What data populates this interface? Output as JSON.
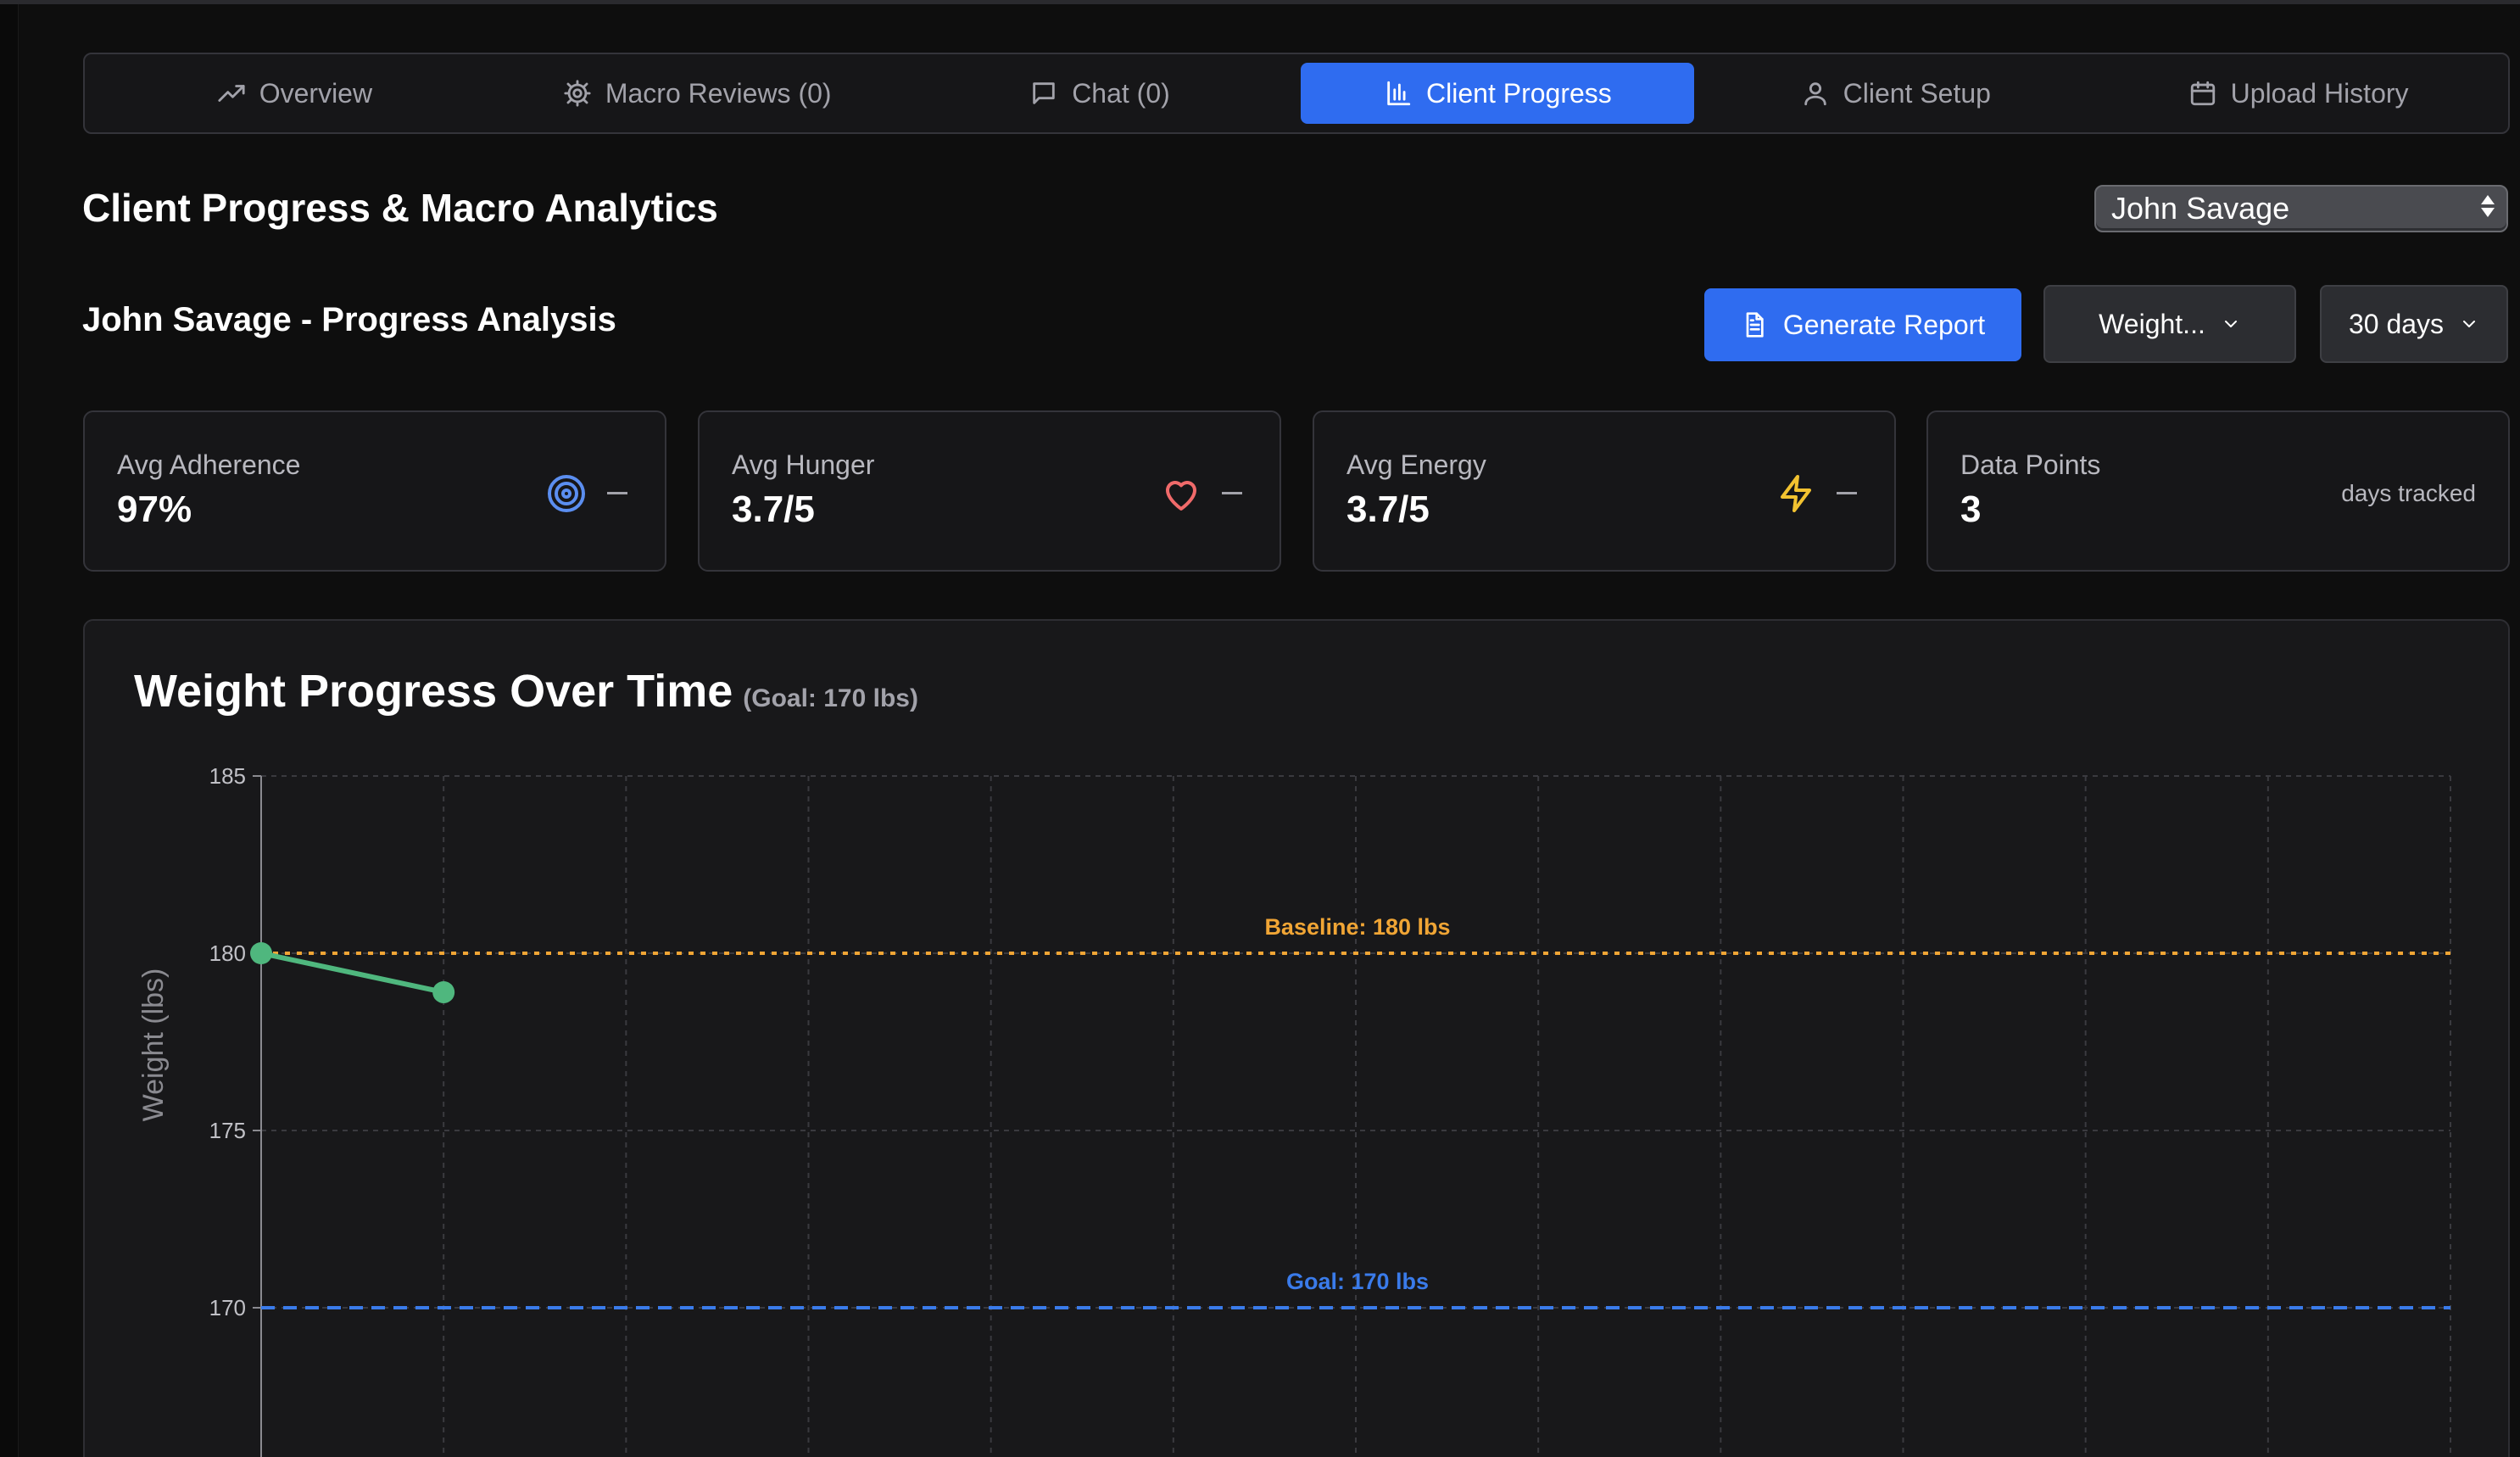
{
  "tabs": [
    {
      "label": "Overview",
      "icon": "trending-up-icon"
    },
    {
      "label": "Macro Reviews (0)",
      "icon": "gear-icon"
    },
    {
      "label": "Chat (0)",
      "icon": "chat-icon"
    },
    {
      "label": "Client Progress",
      "icon": "bar-chart-icon",
      "active": true
    },
    {
      "label": "Client Setup",
      "icon": "user-icon"
    },
    {
      "label": "Upload History",
      "icon": "calendar-icon"
    }
  ],
  "page_title": "Client Progress & Macro Analytics",
  "client_select": {
    "value": "John Savage"
  },
  "section_title": "John Savage - Progress Analysis",
  "actions": {
    "generate_report": "Generate Report",
    "metric_select": "Weight...",
    "range_select": "30 days"
  },
  "stats": [
    {
      "label": "Avg Adherence",
      "value": "97%",
      "icon": "target-icon",
      "icon_color": "#5b8ef0"
    },
    {
      "label": "Avg Hunger",
      "value": "3.7/5",
      "icon": "heart-icon",
      "icon_color": "#f06a6a"
    },
    {
      "label": "Avg Energy",
      "value": "3.7/5",
      "icon": "lightning-icon",
      "icon_color": "#f2c230"
    },
    {
      "label": "Data Points",
      "value": "3",
      "side_text": "days tracked"
    }
  ],
  "chart": {
    "title": "Weight Progress Over Time",
    "subtitle": "(Goal: 170 lbs)"
  },
  "chart_data": {
    "type": "line",
    "title": "Weight Progress Over Time",
    "subtitle": "(Goal: 170 lbs)",
    "ylabel": "Weight (lbs)",
    "xlabel": "",
    "ylim": [
      165,
      185
    ],
    "yticks": [
      185,
      180,
      175,
      170
    ],
    "x_categories": 12,
    "grid": true,
    "series": [
      {
        "values": [
          180,
          178.9
        ],
        "color": "#4fb77e"
      }
    ],
    "reference_lines": [
      {
        "label": "Baseline: 180 lbs",
        "value": 180,
        "color": "#f0a535",
        "style": "dotted"
      },
      {
        "label": "Goal: 170 lbs",
        "value": 170,
        "color": "#3a7bea",
        "style": "dashed"
      }
    ]
  },
  "colors": {
    "accent": "#2f6cf0",
    "background": "#0e0e0e",
    "panel": "#161618"
  }
}
